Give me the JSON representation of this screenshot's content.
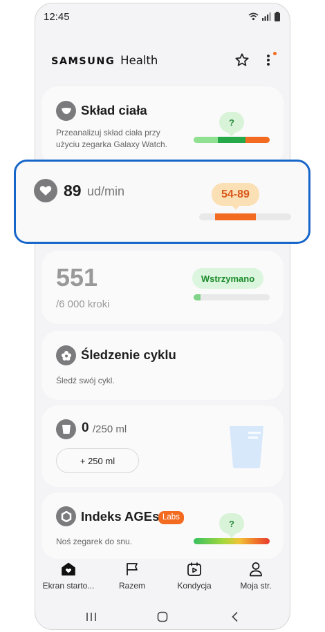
{
  "status_bar": {
    "time": "12:45"
  },
  "header": {
    "brand_bold": "SAMSUNG",
    "brand_light": "Health"
  },
  "body_composition": {
    "title": "Skład ciała",
    "description": "Przeanalizuj skład ciała przy użyciu zegarka Galaxy Watch.",
    "bubble": "?"
  },
  "heart_rate": {
    "value": "89",
    "unit": "ud/min",
    "range": "54-89",
    "colors": {
      "bubble_bg": "#fbe0b6",
      "bubble_text": "#d9581b",
      "bar": "#f36b21"
    }
  },
  "steps": {
    "value": "551",
    "goal": "/6 000 kroki",
    "status": "Wstrzymano",
    "progress": 0.09,
    "colors": {
      "status_bg": "#dcf5de",
      "status_text": "#1a8a2a",
      "bar": "#7fd48a"
    }
  },
  "cycle": {
    "title": "Śledzenie cyklu",
    "description": "Śledź swój cykl."
  },
  "water": {
    "value": "0",
    "goal": "/250 ml",
    "add_button": "+ 250 ml"
  },
  "ages": {
    "title": "Indeks AGEs",
    "badge": "Labs",
    "description": "Noś zegarek do snu.",
    "bubble": "?",
    "colors": {
      "badge_bg": "#f36b21"
    }
  },
  "nav": {
    "items": [
      {
        "label": "Ekran starto...",
        "icon": "home-icon"
      },
      {
        "label": "Razem",
        "icon": "flag-icon"
      },
      {
        "label": "Kondycja",
        "icon": "calendar-play-icon"
      },
      {
        "label": "Moja str.",
        "icon": "person-icon"
      }
    ]
  },
  "colors": {
    "accent_outline": "#1665c9",
    "page_bg": "#f4f4f6",
    "card_bg": "#fafafa"
  }
}
